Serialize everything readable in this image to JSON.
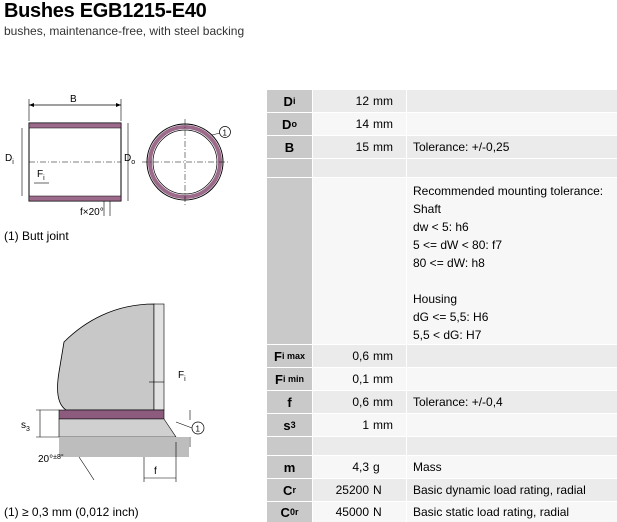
{
  "header": {
    "title": "Bushes EGB1215-E40",
    "subtitle": "bushes, maintenance-free, with steel backing"
  },
  "figure1": {
    "caption": "(1) Butt joint",
    "labels": {
      "B": "B",
      "Di": "D",
      "Di_sub": "i",
      "Do": "D",
      "Do_sub": "o",
      "Fi": "F",
      "Fi_sub": "i",
      "chamfer": "f×20°",
      "callout": "1"
    }
  },
  "figure2": {
    "caption": "(1) ≥ 0,3 mm (0,012 inch)",
    "labels": {
      "Fi": "F",
      "Fi_sub": "i",
      "s3": "s",
      "s3_sub": "3",
      "angle": "20°",
      "angle_tol": "±8°",
      "f": "f",
      "callout": "1"
    }
  },
  "table": {
    "rows": [
      {
        "sym": "D",
        "sub": "i",
        "value": "12",
        "unit": "mm",
        "note": ""
      },
      {
        "sym": "D",
        "sub": "o",
        "value": "14",
        "unit": "mm",
        "note": ""
      },
      {
        "sym": "B",
        "sub": "",
        "value": "15",
        "unit": "mm",
        "note": "Tolerance: +/-0,25"
      },
      {
        "sym": "",
        "sub": "",
        "value": "",
        "unit": "",
        "note": ""
      },
      {
        "sym": "F",
        "sub": "i max",
        "value": "0,6",
        "unit": "mm",
        "note": ""
      },
      {
        "sym": "F",
        "sub": "i min",
        "value": "0,1",
        "unit": "mm",
        "note": ""
      },
      {
        "sym": "f",
        "sub": "",
        "value": "0,6",
        "unit": "mm",
        "note": "Tolerance: +/-0,4"
      },
      {
        "sym": "s",
        "sub": "3",
        "value": "1",
        "unit": "mm",
        "note": ""
      },
      {
        "sym": "m",
        "sub": "",
        "value": "4,3",
        "unit": "g",
        "note": "Mass"
      },
      {
        "sym": "C",
        "sub": "r",
        "value": "25200",
        "unit": "N",
        "note": "Basic dynamic load rating, radial"
      },
      {
        "sym": "C",
        "sub": "0r",
        "value": "45000",
        "unit": "N",
        "note": "Basic static load rating, radial"
      }
    ],
    "tolerance_block": [
      "Recommended mounting tolerance:",
      "Shaft",
      "dw < 5: h6",
      "5 <= dW < 80: f7",
      "80 <= dW: h8",
      "",
      "Housing",
      "dG <= 5,5: H6",
      "5,5 < dG: H7"
    ]
  }
}
